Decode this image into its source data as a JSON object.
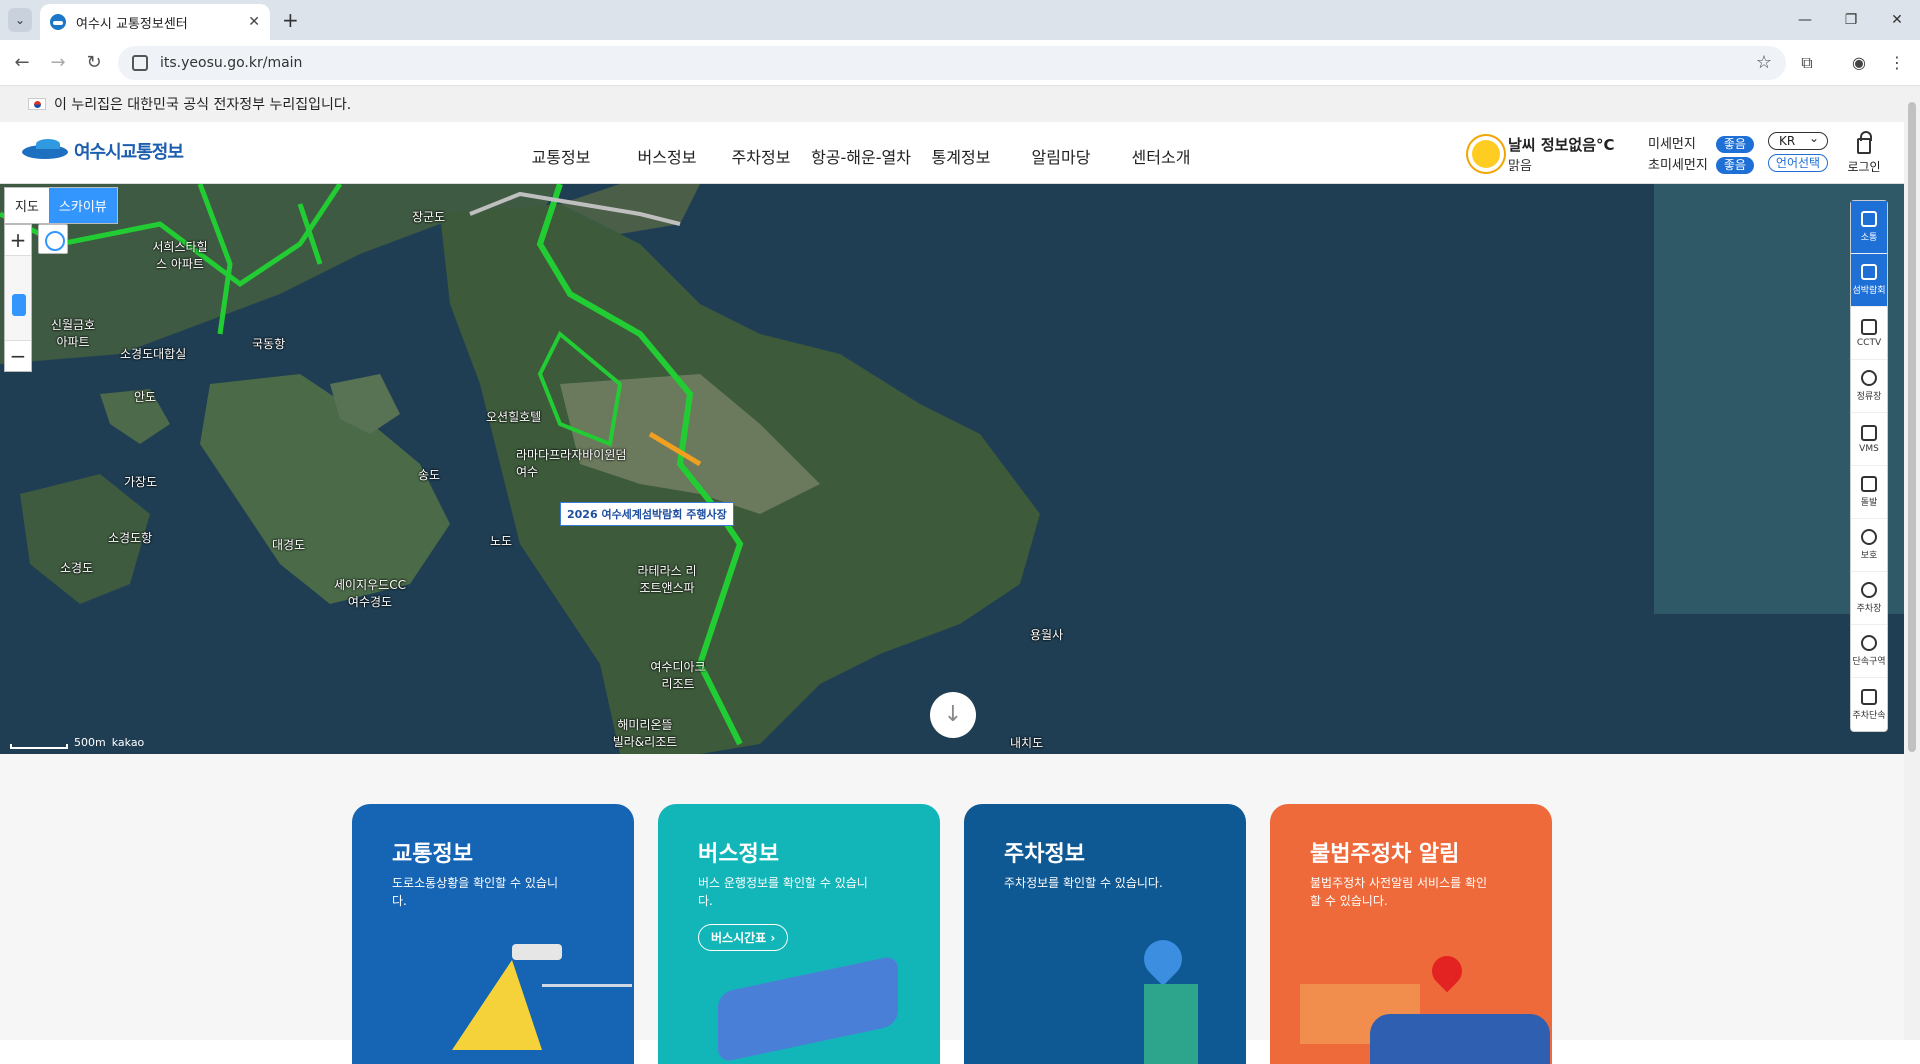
{
  "browser": {
    "tab_title": "여수시 교통정보센터",
    "new_tab": "+",
    "url": "its.yeosu.go.kr/main"
  },
  "gov_banner": {
    "text": "이 누리집은 대한민국 공식 전자정부 누리집입니다."
  },
  "header": {
    "logo_text": "여수시교통정보",
    "nav": [
      "교통정보",
      "버스정보",
      "주차정보",
      "항공-해운-열차",
      "통계정보",
      "알림마당",
      "센터소개"
    ],
    "weather": {
      "title": "날씨 정보없음°C",
      "desc": "맑음"
    },
    "dust": [
      {
        "label": "미세먼지",
        "status": "좋음"
      },
      {
        "label": "초미세먼지",
        "status": "좋음"
      }
    ],
    "lang_value": "KR",
    "lang_button": "언어선택",
    "login": "로그인"
  },
  "map": {
    "toggle": [
      "지도",
      "스카이뷰"
    ],
    "active_toggle": "스카이뷰",
    "zoom_in": "+",
    "zoom_out": "−",
    "event_label": "2026 여수세계섬박람회 주행사장",
    "scale": "500m",
    "provider": "kakao",
    "labels": [
      "장군도",
      "서희스타힐스 아파트",
      "신월금호 아파트",
      "국동항",
      "소경도대합실",
      "오션힐호텔",
      "라마다프라자바이윈덤 여수",
      "가장도",
      "소경도항",
      "소경도",
      "대경도",
      "세이지우드CC 여수경도",
      "송도",
      "노도",
      "라테라스 리조트앤스파",
      "여수디아크 리조트",
      "해미리온뜰 빌라&리조트",
      "용월사",
      "내치도",
      "안도"
    ],
    "side_menu": [
      "소통",
      "섬박람회",
      "CCTV",
      "정류장",
      "VMS",
      "돌발",
      "보호",
      "주차장",
      "단속구역",
      "주차단속"
    ]
  },
  "cards": [
    {
      "title": "교통정보",
      "desc": "도로소통상황을 확인할 수 있습니다.",
      "color": "#1664b4"
    },
    {
      "title": "버스정보",
      "desc": "버스 운행정보를 확인할 수 있습니다.",
      "button": "버스시간표",
      "color": "#13b6b8"
    },
    {
      "title": "주차정보",
      "desc": "주차정보를 확인할 수 있습니다.",
      "color": "#0e5893"
    },
    {
      "title": "불법주정차 알림",
      "desc": "불법주정차 사전알림 서비스를 확인할 수 있습니다.",
      "color": "#ef6a3a"
    }
  ]
}
